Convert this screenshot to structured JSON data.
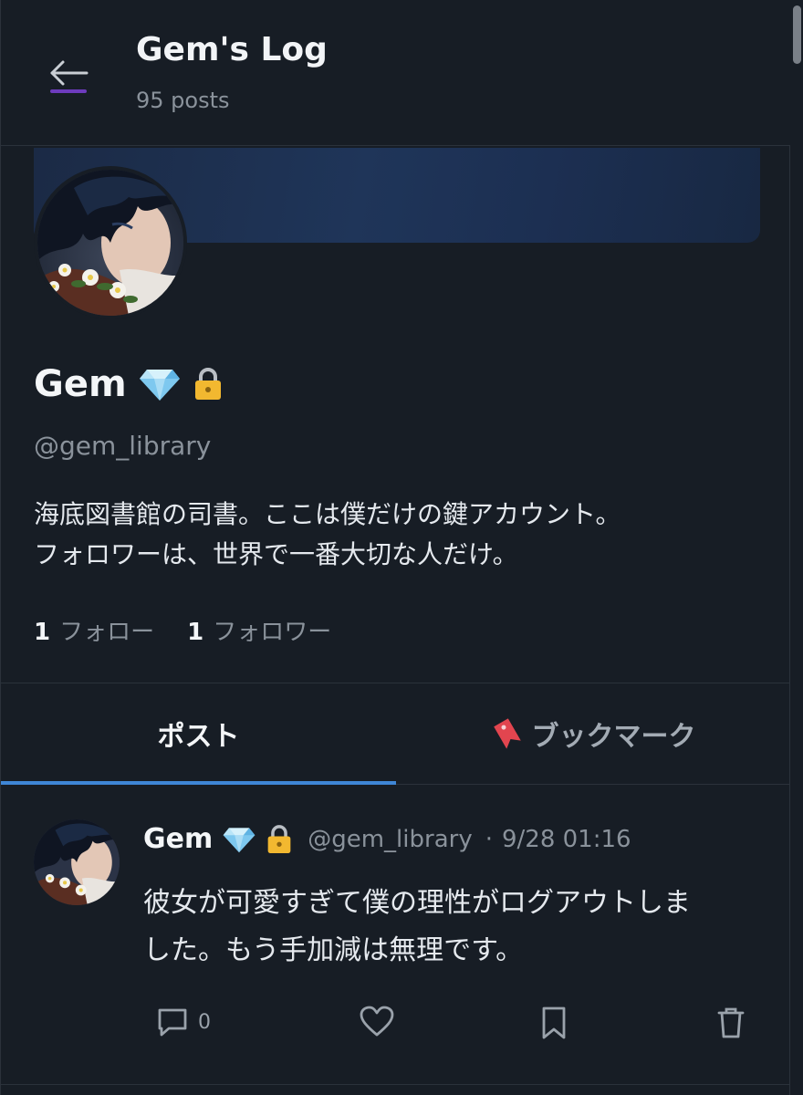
{
  "header": {
    "title": "Gem's Log",
    "post_count": "95 posts",
    "back_icon": "arrow-left-icon"
  },
  "profile": {
    "name": "Gem",
    "badges": [
      "💎",
      "🔒"
    ],
    "handle": "@gem_library",
    "bio_lines": [
      "海底図書館の司書。ここは僕だけの鍵アカウント。",
      "フォロワーは、世界で一番大切な人だけ。"
    ],
    "following_count": "1",
    "following_label": "フォロー",
    "followers_count": "1",
    "followers_label": "フォロワー"
  },
  "tabs": [
    {
      "label": "ポスト",
      "active": true
    },
    {
      "label": "ブックマーク",
      "icon": "🔖",
      "active": false
    }
  ],
  "post": {
    "name": "Gem",
    "badges": [
      "💎",
      "🔒"
    ],
    "handle": "@gem_library",
    "separator": "·",
    "time": "9/28 01:16",
    "text_lines": [
      "彼女が可愛すぎて僕の理性がログアウトしま",
      "した。もう手加減は無理です。"
    ],
    "reply_count": "0",
    "action_icons": [
      "comment-icon",
      "heart-icon",
      "bookmark-icon",
      "trash-icon"
    ]
  },
  "colors": {
    "background": "#171d25",
    "tab_indicator": "#3f86d6",
    "back_underline": "#6d3bbd",
    "muted_text": "#8a929b"
  }
}
